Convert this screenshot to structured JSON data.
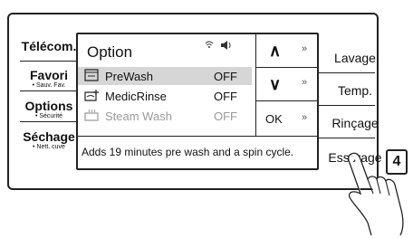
{
  "left_buttons": [
    {
      "label": "Télécom.",
      "sub": ""
    },
    {
      "label": "Favori",
      "sub": "• Sauv. Fav."
    },
    {
      "label": "Options",
      "sub": "• Sécurité"
    },
    {
      "label": "Séchage",
      "sub": "• Nett. cuve"
    }
  ],
  "right_buttons": [
    "Lavage",
    "Temp.",
    "Rinçage",
    "Essorage"
  ],
  "screen": {
    "title": "Option",
    "status_icons": [
      "wifi-icon",
      "speaker-icon"
    ],
    "options": [
      {
        "name": "PreWash",
        "value": "OFF",
        "icon": "prewash-icon",
        "state": "selected"
      },
      {
        "name": "MedicRinse",
        "value": "OFF",
        "icon": "medicrinse-icon",
        "state": "normal"
      },
      {
        "name": "Steam Wash",
        "value": "OFF",
        "icon": "steamwash-icon",
        "state": "disabled"
      }
    ],
    "nav": {
      "up": "∧",
      "down": "∨",
      "ok": "OK",
      "more": "»"
    },
    "description": "Adds 19 minutes pre wash and a spin cycle."
  },
  "step_badge": "4"
}
